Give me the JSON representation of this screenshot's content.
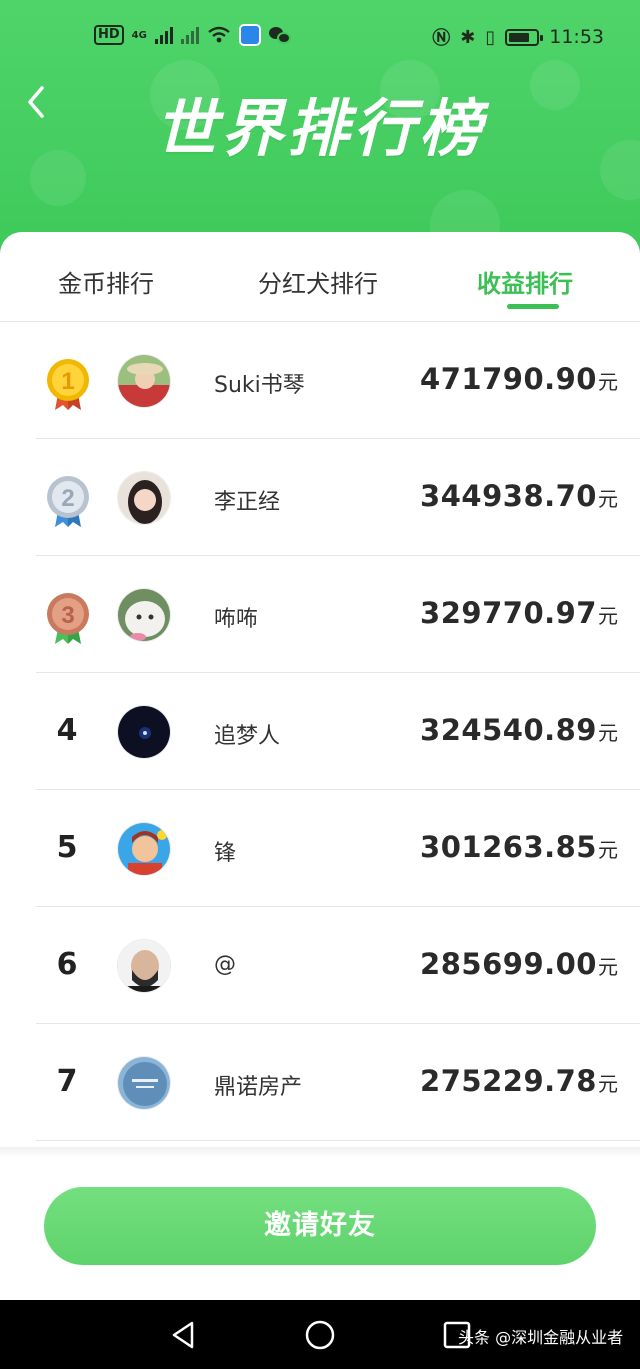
{
  "status_bar": {
    "chip": "HD",
    "network": "4G",
    "time": "11:53"
  },
  "header": {
    "title": "世界排行榜"
  },
  "tabs": [
    {
      "label": "金币排行",
      "active": false
    },
    {
      "label": "分红犬排行",
      "active": false
    },
    {
      "label": "收益排行",
      "active": true
    }
  ],
  "ranking": [
    {
      "rank": "1",
      "medal": "gold-medal-icon",
      "name": "Suki书琴",
      "amount": "471790.90",
      "unit": "元",
      "avatar": "photo-woman-hat"
    },
    {
      "rank": "2",
      "medal": "silver-medal-icon",
      "name": "李正经",
      "amount": "344938.70",
      "unit": "元",
      "avatar": "photo-woman-selfie"
    },
    {
      "rank": "3",
      "medal": "bronze-medal-icon",
      "name": "咘咘",
      "amount": "329770.97",
      "unit": "元",
      "avatar": "photo-white-cat"
    },
    {
      "rank": "4",
      "name": "追梦人",
      "amount": "324540.89",
      "unit": "元",
      "avatar": "dark-space-star"
    },
    {
      "rank": "5",
      "name": "锋",
      "amount": "301263.85",
      "unit": "元",
      "avatar": "cartoon-boy"
    },
    {
      "rank": "6",
      "name": "@",
      "amount": "285699.00",
      "unit": "元",
      "avatar": "photo-man-bald"
    },
    {
      "rank": "7",
      "name": "鼎诺房产",
      "amount": "275229.78",
      "unit": "元",
      "avatar": "logo-blue-circle"
    }
  ],
  "footer": {
    "invite_label": "邀请好友"
  },
  "navbar": {
    "watermark": "头条 @深圳金融从业者"
  },
  "colors": {
    "brand_green": "#3ec95a",
    "active_tab": "#3cc055",
    "button_green": "#5ed36c"
  }
}
